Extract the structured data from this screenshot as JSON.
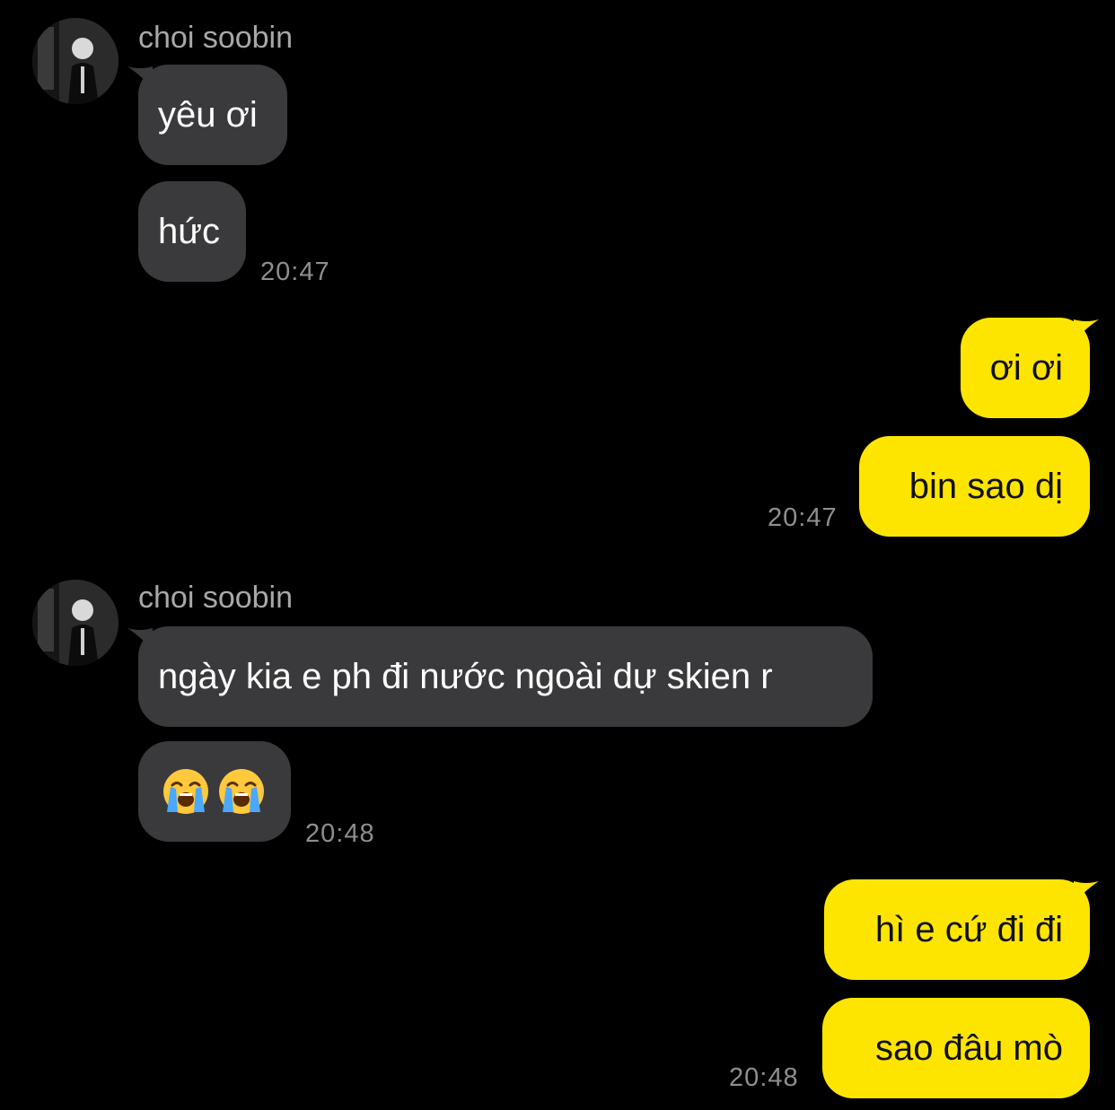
{
  "messages": [
    {
      "side": "in",
      "sender": "choi soobin",
      "text": "yêu ơi"
    },
    {
      "side": "in",
      "text": "hức",
      "time": "20:47"
    },
    {
      "side": "out",
      "text": "ơi ơi"
    },
    {
      "side": "out",
      "text": "bin sao dị",
      "time": "20:47"
    },
    {
      "side": "in",
      "sender": "choi soobin",
      "text": "ngày kia e ph đi nước ngoài dự skien r"
    },
    {
      "side": "in",
      "emoji": [
        "loudly-crying-face",
        "loudly-crying-face"
      ],
      "time": "20:48"
    },
    {
      "side": "out",
      "text": "hì e cứ đi đi"
    },
    {
      "side": "out",
      "text": "sao đâu mò",
      "time": "20:48"
    }
  ],
  "colors": {
    "background": "#000000",
    "incoming_bubble": "#3a3a3c",
    "outgoing_bubble": "#fee500",
    "sender_name": "#a8a8a8",
    "timestamp": "#8e8e8e"
  }
}
